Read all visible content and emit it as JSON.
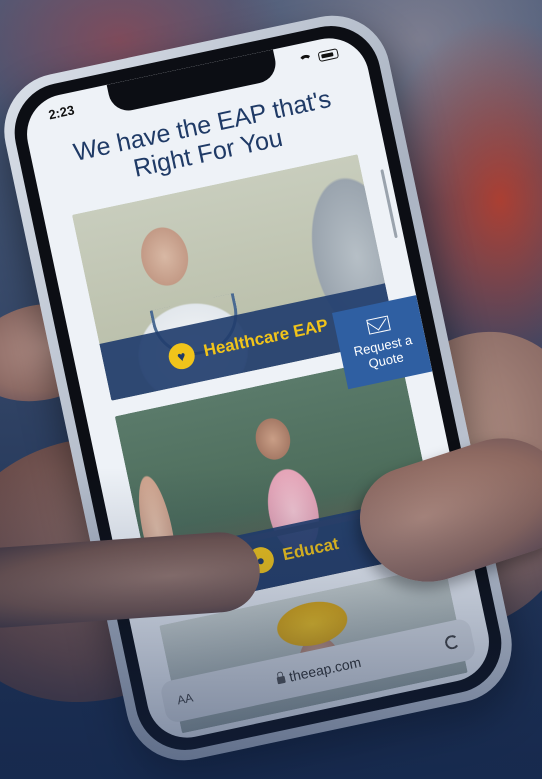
{
  "status_bar": {
    "time": "2:23"
  },
  "page": {
    "heading_line1": "We have the EAP that's",
    "heading_line2": "Right For You"
  },
  "cards": [
    {
      "label": "Healthcare EAP",
      "icon": "heart-icon"
    },
    {
      "label": "Educat",
      "icon": "apple-icon"
    },
    {
      "label": "",
      "icon": "hard-hat-icon"
    }
  ],
  "quote_button": {
    "line1": "Request a",
    "line2": "Quote",
    "icon": "mail-icon"
  },
  "browser": {
    "text_size": "AA",
    "url": "theeap.com"
  },
  "colors": {
    "brand_navy": "#223e6e",
    "accent_yellow": "#f1c41a",
    "button_blue": "#2f5fa2"
  }
}
